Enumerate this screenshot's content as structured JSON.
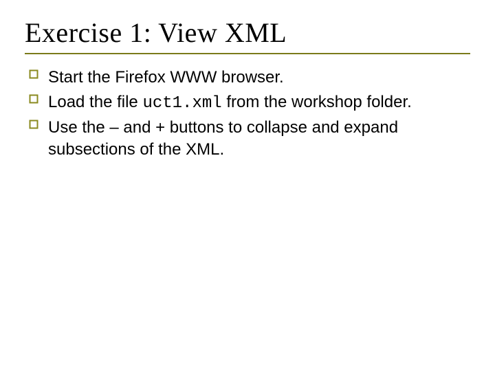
{
  "title": "Exercise 1: View XML",
  "bullet_glyph": "◻",
  "bullets": [
    {
      "pre": "Start the Firefox WWW browser.",
      "code": "",
      "post": ""
    },
    {
      "pre": "Load the file ",
      "code": "uct1.xml",
      "post": " from the workshop folder."
    },
    {
      "pre": "Use the – and + buttons to collapse and expand subsections of the XML.",
      "code": "",
      "post": ""
    }
  ],
  "colors": {
    "rule": "#7a7a1a",
    "bullet": "#8a8a1f"
  }
}
